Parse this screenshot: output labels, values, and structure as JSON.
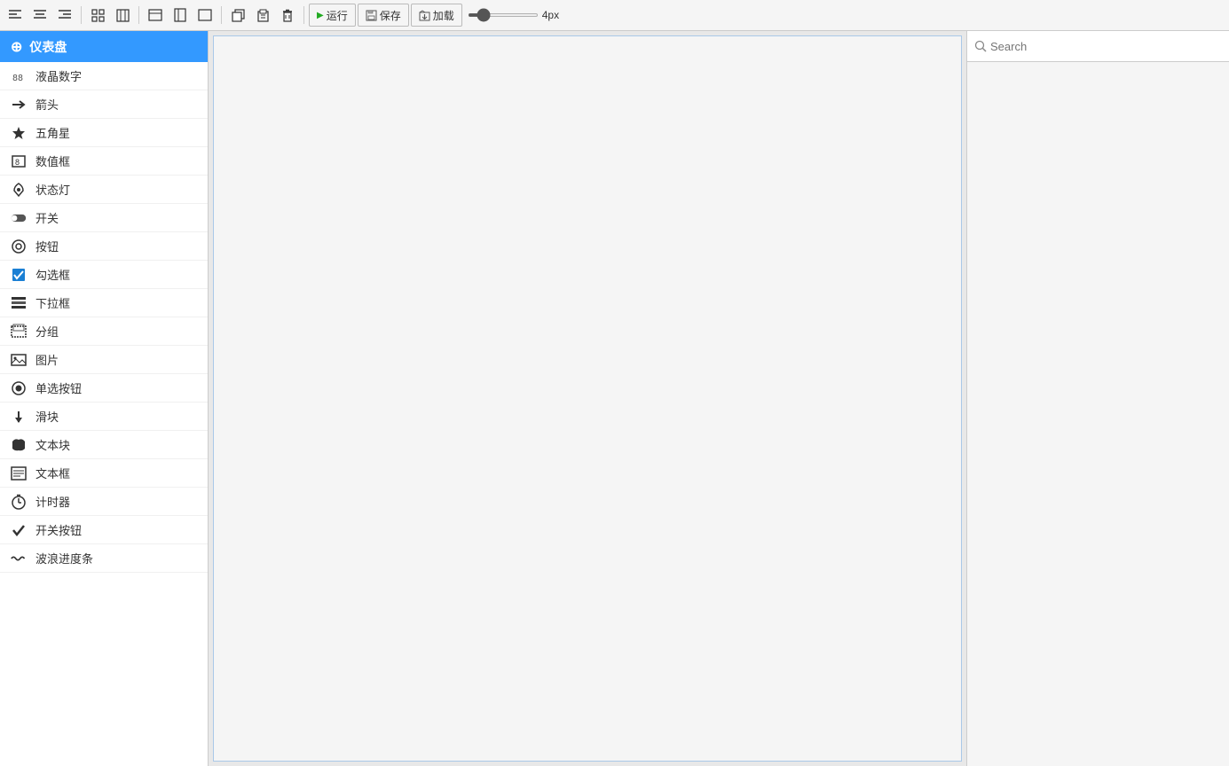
{
  "toolbar": {
    "align_left_label": "≡",
    "align_center_label": "≡",
    "align_right_label": "≡",
    "grid1_label": "⊞",
    "grid2_label": "⊟",
    "box1_label": "▭",
    "box2_label": "▯",
    "box3_label": "▭",
    "copy_label": "⧉",
    "paste_label": "⧇",
    "delete_label": "✕",
    "run_label": "运行",
    "save_label": "保存",
    "load_label": "加载",
    "stroke_value": "4px"
  },
  "sidebar": {
    "header": {
      "label": "仪表盘",
      "icon": "dashboard"
    },
    "items": [
      {
        "id": "liquid-number",
        "label": "液晶数字",
        "icon": "💧"
      },
      {
        "id": "arrow",
        "label": "箭头",
        "icon": "➡"
      },
      {
        "id": "star",
        "label": "五角星",
        "icon": "★"
      },
      {
        "id": "number-box",
        "label": "数值框",
        "icon": "8"
      },
      {
        "id": "status-light",
        "label": "状态灯",
        "icon": "🔔"
      },
      {
        "id": "switch",
        "label": "开关",
        "icon": "🔘"
      },
      {
        "id": "button",
        "label": "按钮",
        "icon": "🖱"
      },
      {
        "id": "checkbox",
        "label": "勾选框",
        "icon": "☑"
      },
      {
        "id": "dropdown",
        "label": "下拉框",
        "icon": "☰"
      },
      {
        "id": "group",
        "label": "分组",
        "icon": "⊞"
      },
      {
        "id": "image",
        "label": "图片",
        "icon": "🖼"
      },
      {
        "id": "radio",
        "label": "单选按钮",
        "icon": "⊙"
      },
      {
        "id": "slider",
        "label": "滑块",
        "icon": "⬇"
      },
      {
        "id": "text-block",
        "label": "文本块",
        "icon": "🏷"
      },
      {
        "id": "text-box",
        "label": "文本框",
        "icon": "📋"
      },
      {
        "id": "timer",
        "label": "计时器",
        "icon": "⏱"
      },
      {
        "id": "toggle-btn",
        "label": "开关按钮",
        "icon": "✔"
      },
      {
        "id": "wave-progress",
        "label": "波浪进度条",
        "icon": "〜"
      }
    ]
  },
  "canvas": {
    "placeholder": ""
  },
  "right_panel": {
    "search": {
      "placeholder": "Search",
      "value": ""
    }
  }
}
